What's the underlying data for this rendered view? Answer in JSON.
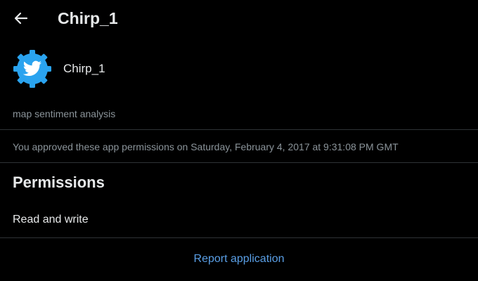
{
  "header": {
    "back_icon": "arrow-left-icon",
    "title": "Chirp_1"
  },
  "app": {
    "logo_icon": "bird-gear-logo",
    "name": "Chirp_1",
    "description": "map sentiment analysis",
    "logo_color": "#2aa3ef"
  },
  "approval": {
    "text": "You approved these app permissions on Saturday, February 4, 2017 at 9:31:08 PM GMT"
  },
  "permissions": {
    "heading": "Permissions",
    "value": "Read and write"
  },
  "footer": {
    "report_label": "Report application"
  },
  "colors": {
    "background": "#000000",
    "primary_text": "#e7e9ea",
    "secondary_text": "#8b949a",
    "divider": "#2f3336",
    "link": "#5a9fe6"
  }
}
